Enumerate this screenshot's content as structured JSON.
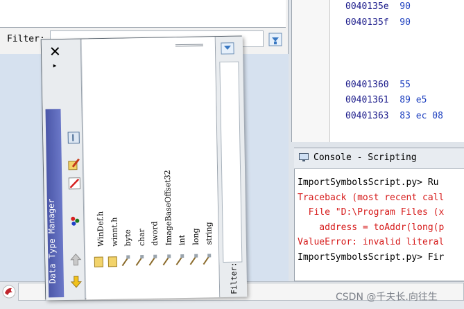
{
  "filter": {
    "label": "Filter:"
  },
  "listing": {
    "rows": [
      {
        "addr": "0040135e",
        "bytes": "90"
      },
      {
        "addr": "0040135f",
        "bytes": "90"
      },
      {
        "addr": "00401360",
        "bytes": "55"
      },
      {
        "addr": "00401361",
        "bytes": "89 e5"
      },
      {
        "addr": "00401363",
        "bytes": "83 ec 08"
      }
    ]
  },
  "console": {
    "title": "Console - Scripting",
    "lines": [
      {
        "text": "ImportSymbolsScript.py> Ru",
        "color": "#000000"
      },
      {
        "text": "Traceback (most recent call",
        "color": "#d61a1a"
      },
      {
        "text": "  File \"D:\\Program Files (x",
        "color": "#d61a1a"
      },
      {
        "text": "    address = toAddr(long(p",
        "color": "#d61a1a"
      },
      {
        "text": "ValueError: invalid literal",
        "color": "#d61a1a"
      },
      {
        "text": "ImportSymbolsScript.py> Fir",
        "color": "#000000"
      }
    ]
  },
  "dtm": {
    "title": "Data Type Manager",
    "close": "✕",
    "menu": "▸",
    "filter_label": "Filter:",
    "tree_items": [
      "WinDef.h",
      "winnt.h",
      "byte",
      "char",
      "dword",
      "ImageBaseOffset32",
      "int",
      "long",
      "string"
    ],
    "toolbar_icons": [
      "window-icon",
      "edit-datatype-icon",
      "no-edit-icon",
      "colors-icon",
      "up-arrow-icon",
      "down-arrow-icon"
    ]
  },
  "watermark": "CSDN @千夫长.向往生"
}
